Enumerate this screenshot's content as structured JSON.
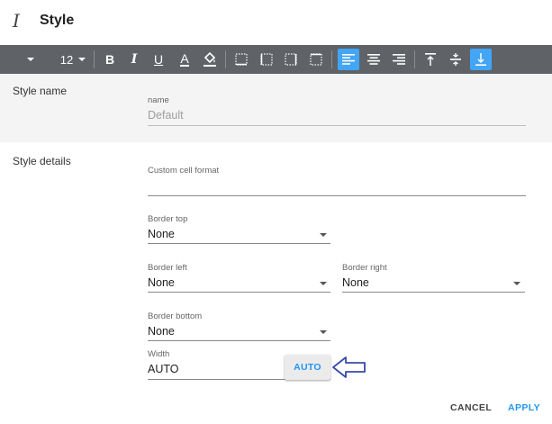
{
  "dialog": {
    "title": "Style",
    "title_icon": "text-cursor-icon"
  },
  "toolbar": {
    "font_size": "12",
    "buttons": [
      {
        "name": "font-dropdown",
        "icon": "caret-down-icon"
      },
      {
        "name": "bold",
        "label": "B"
      },
      {
        "name": "italic",
        "label": "I"
      },
      {
        "name": "underline",
        "label": "U"
      },
      {
        "name": "font-color",
        "label": "A"
      },
      {
        "name": "fill-color",
        "icon": "paint-bucket-icon"
      },
      {
        "name": "borders-all",
        "icon": "borders-all-icon"
      },
      {
        "name": "borders-inner",
        "icon": "borders-inner-icon"
      },
      {
        "name": "borders-outer",
        "icon": "borders-outer-icon"
      },
      {
        "name": "borders-none",
        "icon": "borders-none-icon"
      },
      {
        "name": "align-left",
        "icon": "align-left-icon",
        "active": true
      },
      {
        "name": "align-center",
        "icon": "align-center-icon"
      },
      {
        "name": "align-right",
        "icon": "align-right-icon"
      },
      {
        "name": "valign-top",
        "icon": "valign-top-icon"
      },
      {
        "name": "valign-middle",
        "icon": "valign-middle-icon"
      },
      {
        "name": "valign-bottom",
        "icon": "valign-bottom-icon",
        "active": true
      }
    ],
    "active_color": "#42a5f5",
    "background_color": "#5f6368"
  },
  "style_name": {
    "section_label": "Style name",
    "field_label": "name",
    "placeholder": "Default"
  },
  "style_details": {
    "section_label": "Style details",
    "custom_format": {
      "label": "Custom cell format",
      "value": ""
    },
    "border_top": {
      "label": "Border top",
      "value": "None"
    },
    "border_left": {
      "label": "Border left",
      "value": "None"
    },
    "border_right": {
      "label": "Border right",
      "value": "None"
    },
    "border_bottom": {
      "label": "Border bottom",
      "value": "None"
    },
    "width": {
      "label": "Width",
      "value": "AUTO",
      "button_label": "AUTO"
    }
  },
  "annotation": {
    "arrow_color": "#3949ab",
    "target": "auto-button"
  },
  "actions": {
    "cancel_label": "CANCEL",
    "apply_label": "APPLY",
    "accent_color": "#2196f3"
  }
}
